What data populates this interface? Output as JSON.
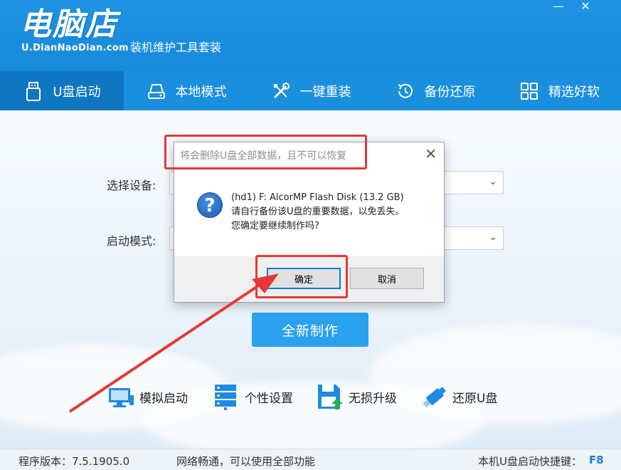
{
  "header": {
    "logo": "电脑店",
    "url": "U.DianNaoDian.com",
    "tagline": "装机维护工具套装",
    "minimize": "—",
    "close": "✕"
  },
  "nav": [
    {
      "label": "U盘启动",
      "icon": "usb-drive-icon",
      "active": true
    },
    {
      "label": "本地模式",
      "icon": "hard-disk-icon",
      "active": false
    },
    {
      "label": "一键重装",
      "icon": "tools-icon",
      "active": false
    },
    {
      "label": "备份还原",
      "icon": "history-icon",
      "active": false
    },
    {
      "label": "精选好软",
      "icon": "grid-apps-icon",
      "active": false
    }
  ],
  "form": {
    "device_label": "选择设备:",
    "mode_label": "启动模式:"
  },
  "make_button": "全新制作",
  "tools": [
    {
      "label": "模拟启动",
      "icon": "monitor-icon"
    },
    {
      "label": "个性设置",
      "icon": "server-settings-icon"
    },
    {
      "label": "无损升级",
      "icon": "save-upgrade-icon"
    },
    {
      "label": "还原U盘",
      "icon": "usb-restore-icon"
    }
  ],
  "status": {
    "version": "程序版本：7.5.1905.0",
    "network": "网络畅通，可以使用全部功能",
    "hotkey_label": "本机U盘启动快捷键：",
    "hotkey": "F8"
  },
  "dialog": {
    "title": "将会删除U盘全部数据，且不可以恢复",
    "close": "✕",
    "icon": "?",
    "line1": "(hd1) F: AlcorMP Flash Disk (13.2 GB)",
    "line2": "请自行备份该U盘的重要数据，以免丢失。",
    "line3": "您确定要继续制作吗?",
    "ok": "确定",
    "cancel": "取消"
  },
  "colors": {
    "brand_blue": "#1a8fde",
    "annotation_red": "#e53935"
  }
}
